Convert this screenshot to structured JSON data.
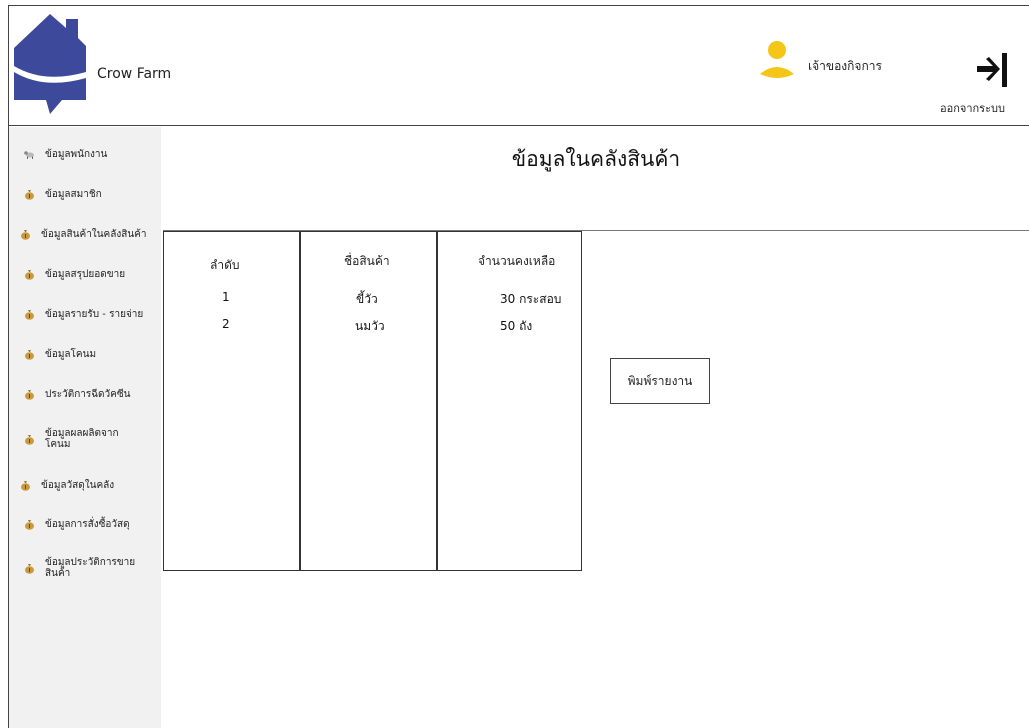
{
  "header": {
    "brand": "Crow Farm",
    "user_role": "เจ้าของกิจการ",
    "logout_label": "ออกจากระบบ"
  },
  "sidebar": {
    "items": [
      {
        "label": "ข้อมูลพนักงาน",
        "icon": "cow-icon"
      },
      {
        "label": "ข้อมูลสมาชิก",
        "icon": "money-bag-icon"
      },
      {
        "label": "ข้อมูลสินค้าในคลังสินค้า",
        "icon": "money-bag-icon"
      },
      {
        "label": "ข้อมูลสรุปยอดขาย",
        "icon": "money-bag-icon"
      },
      {
        "label": "ข้อมูลรายรับ - รายจ่าย",
        "icon": "money-bag-icon"
      },
      {
        "label": "ข้อมูลโคนม",
        "icon": "money-bag-icon"
      },
      {
        "label": "ประวัติการฉีดวัคซีน",
        "icon": "money-bag-icon"
      },
      {
        "label": "ข้อมูลผลผลิตจากโคนม",
        "icon": "money-bag-icon"
      },
      {
        "label": "ข้อมูลวัสดุในคลัง",
        "icon": "money-bag-icon"
      },
      {
        "label": "ข้อมูลการสั่งซื้อวัสดุ",
        "icon": "money-bag-icon"
      },
      {
        "label": "ข้อมูลประวัติการขายสินค้า",
        "icon": "money-bag-icon"
      }
    ]
  },
  "main": {
    "title": "ข้อมูลในคลังสินค้า",
    "table": {
      "headers": [
        "ลำดับ",
        "ชื่อสินค้า",
        "จำนวนคงเหลือ"
      ],
      "rows": [
        [
          "1",
          "ขี้วัว",
          "30 กระสอบ"
        ],
        [
          "2",
          "นมวัว",
          "50 ถัง"
        ]
      ]
    },
    "print_button": "พิมพ์รายงาน"
  },
  "colors": {
    "logo_blue": "#3d4a9c",
    "avatar_yellow": "#f5c518",
    "sidebar_bg": "#f1f1f1"
  }
}
